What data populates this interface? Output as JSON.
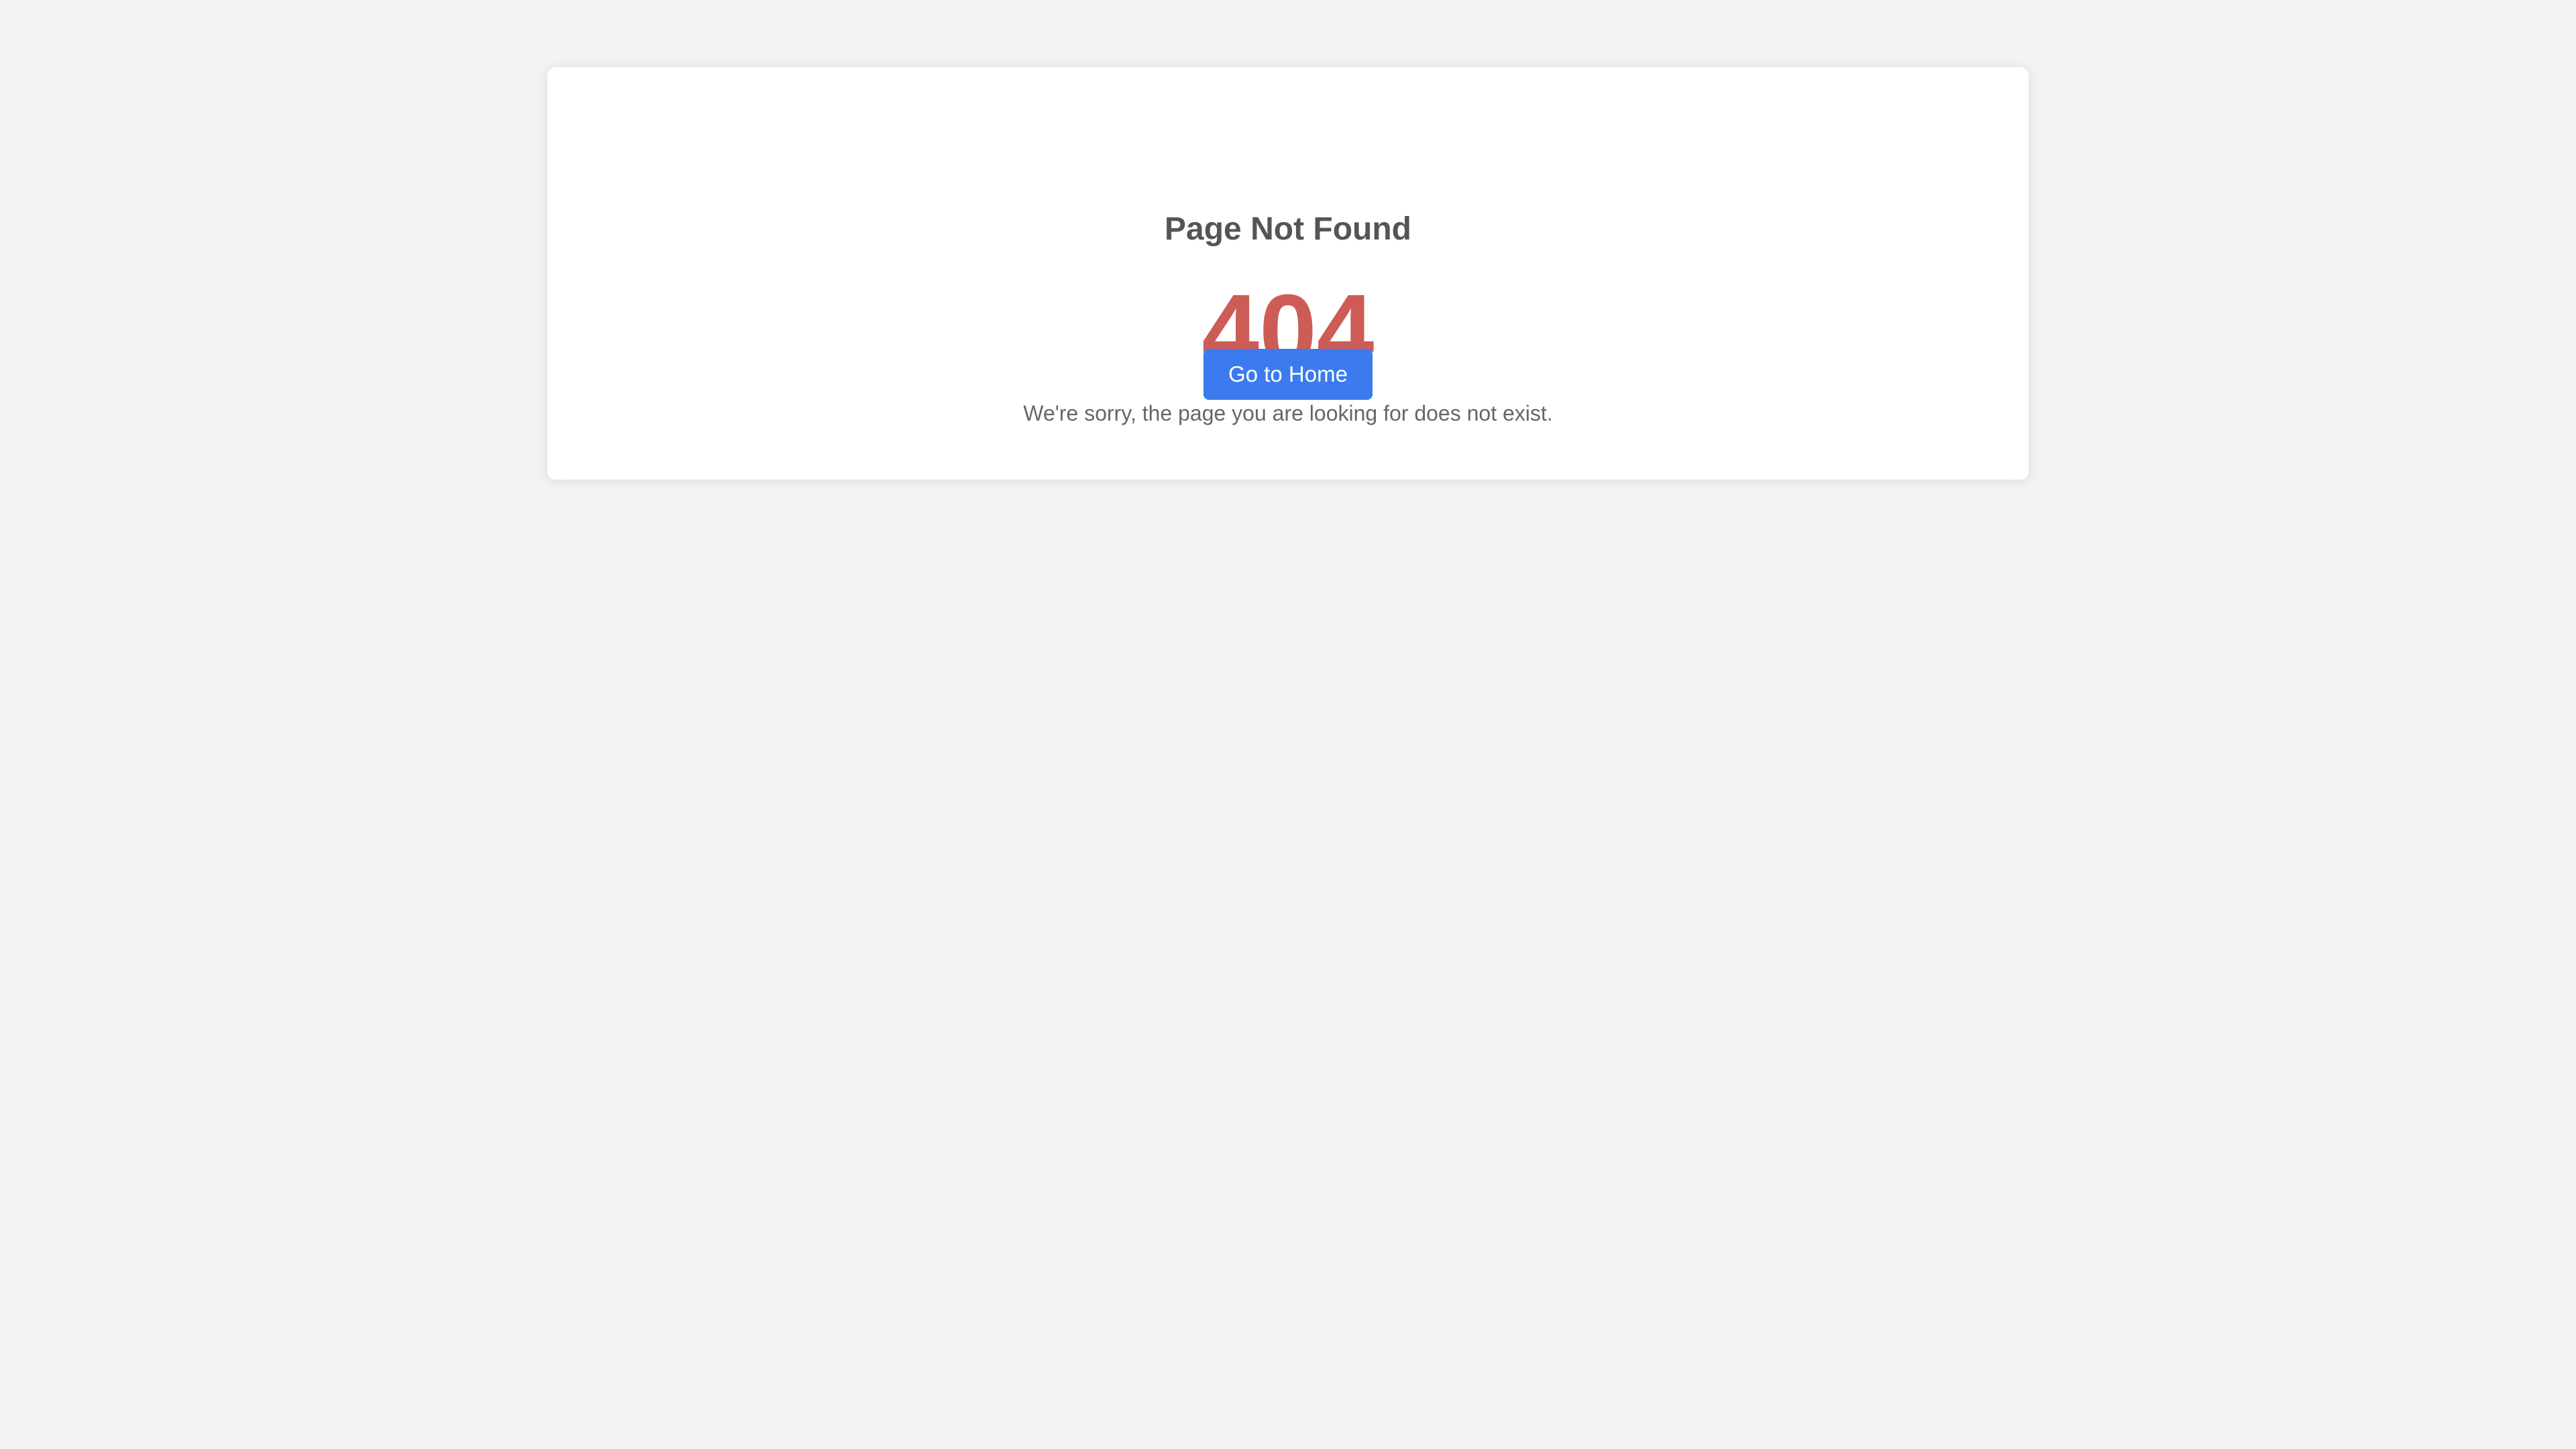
{
  "error_card": {
    "title": "Page Not Found",
    "code": "404",
    "home_button_label": "Go to Home",
    "message": "We're sorry, the page you are looking for does not exist."
  },
  "colors": {
    "background": "#f3f3f3",
    "card": "#ffffff",
    "error_code": "#cd5c57",
    "button": "#3b7bed",
    "text": "#555555"
  }
}
